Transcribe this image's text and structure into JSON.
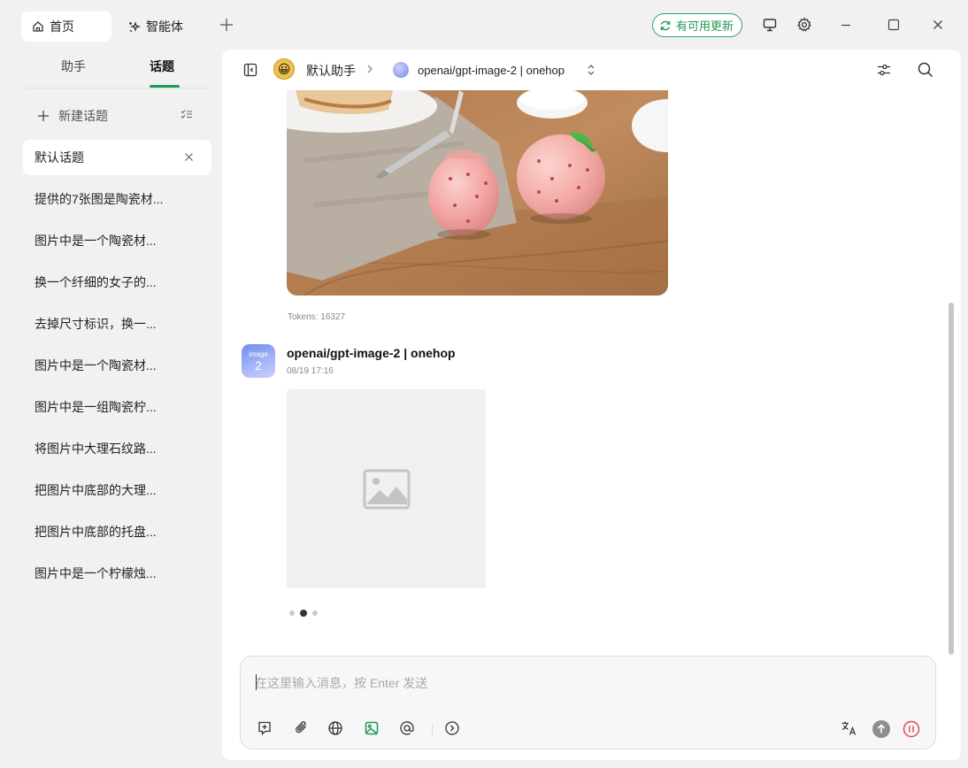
{
  "titlebar": {
    "tabs": [
      {
        "label": "首页",
        "icon": "home-icon"
      },
      {
        "label": "智能体",
        "icon": "sparkle-icon"
      }
    ],
    "update_label": "有可用更新"
  },
  "sidebar": {
    "tabs": [
      {
        "label": "助手"
      },
      {
        "label": "话题"
      }
    ],
    "new_topic_label": "新建话题",
    "topics": [
      {
        "label": "默认话题"
      },
      {
        "label": "提供的7张图是陶瓷材..."
      },
      {
        "label": "图片中是一个陶瓷材..."
      },
      {
        "label": "换一个纤细的女子的..."
      },
      {
        "label": "去掉尺寸标识，换一..."
      },
      {
        "label": "图片中是一个陶瓷材..."
      },
      {
        "label": "图片中是一组陶瓷柠..."
      },
      {
        "label": "将图片中大理石纹路..."
      },
      {
        "label": "把图片中底部的大理..."
      },
      {
        "label": "把图片中底部的托盘..."
      },
      {
        "label": "图片中是一个柠檬烛..."
      }
    ]
  },
  "header": {
    "assistant_emoji": "😀",
    "assistant_name": "默认助手",
    "model_name": "openai/gpt-image-2 | onehop"
  },
  "chat": {
    "tokens": "Tokens: 16327",
    "message": {
      "avatar_line1": "image",
      "avatar_line2": "2",
      "author": "openai/gpt-image-2 | onehop",
      "time": "08/19 17:16"
    },
    "carousel": {
      "count": 3,
      "active": 2
    }
  },
  "composer": {
    "placeholder": "在这里输入消息，按 Enter 发送"
  },
  "colors": {
    "accent": "#1e9a55",
    "stop": "#e5484d"
  }
}
